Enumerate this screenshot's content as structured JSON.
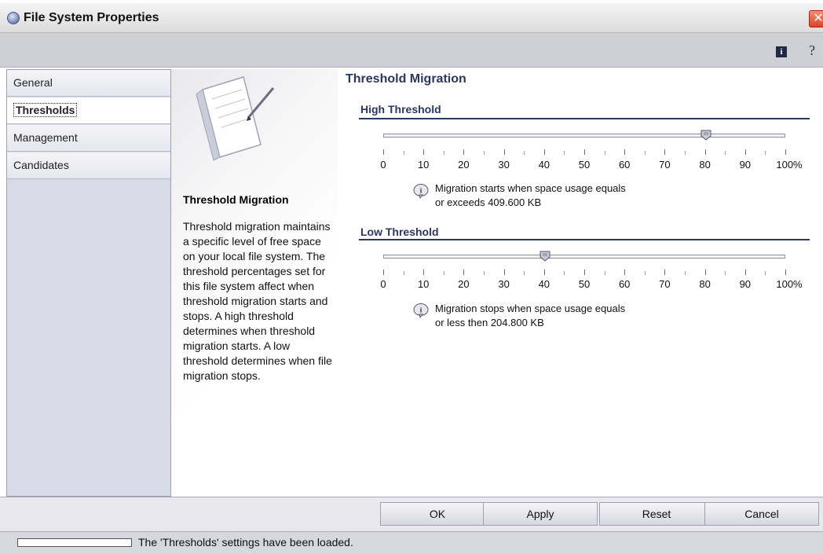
{
  "window": {
    "title": "File System Properties"
  },
  "toolbar": {
    "info_icon": "info-icon",
    "help_icon": "help-icon"
  },
  "nav": {
    "items": [
      {
        "label": "General",
        "active": false
      },
      {
        "label": "Thresholds",
        "active": true
      },
      {
        "label": "Management",
        "active": false
      },
      {
        "label": "Candidates",
        "active": false
      }
    ]
  },
  "description": {
    "heading": "Threshold Migration",
    "body": "Threshold migration maintains a specific level of free space on your local file system. The threshold percentages set for this file system affect when threshold migration starts and stops. A high threshold determines when threshold migration starts. A low threshold determines when file migration stops."
  },
  "main": {
    "section_title": "Threshold Migration",
    "tick_labels": [
      "0",
      "10",
      "20",
      "30",
      "40",
      "50",
      "60",
      "70",
      "80",
      "90",
      "100%"
    ],
    "high": {
      "title": "High Threshold",
      "value_percent": 80,
      "message_line1": "Migration starts when space usage equals",
      "message_line2": "or exceeds 409.600 KB"
    },
    "low": {
      "title": "Low Threshold",
      "value_percent": 40,
      "message_line1": "Migration stops when space usage equals",
      "message_line2": "or less then 204.800 KB"
    }
  },
  "buttons": {
    "ok": "OK",
    "apply": "Apply",
    "reset": "Reset",
    "cancel": "Cancel"
  },
  "status": {
    "text": "The 'Thresholds' settings have been loaded."
  },
  "colors": {
    "accent": "#2a3760",
    "nav_bg": "#d8dae8",
    "toolbar_bg": "#cfcfd6"
  }
}
